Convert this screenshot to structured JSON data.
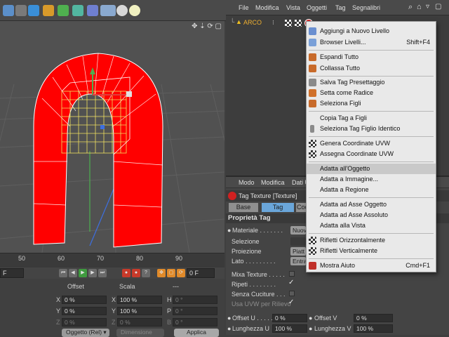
{
  "object_manager": {
    "menus": [
      "File",
      "Modifica",
      "Vista",
      "Oggetti",
      "Tag",
      "Segnalibri"
    ],
    "object_name": "ARCO"
  },
  "context_menu": {
    "items": [
      {
        "label": "Aggiungi a Nuovo Livello",
        "shortcut": ""
      },
      {
        "label": "Browser Livelli...",
        "shortcut": "Shift+F4"
      },
      {
        "label": "Espandi Tutto",
        "shortcut": ""
      },
      {
        "label": "Collassa Tutto",
        "shortcut": ""
      },
      {
        "label": "Salva Tag Presettaggio",
        "shortcut": ""
      },
      {
        "label": "Setta come Radice",
        "shortcut": ""
      },
      {
        "label": "Seleziona Figli",
        "shortcut": ""
      },
      {
        "label": "Copia Tag a Figli",
        "shortcut": ""
      },
      {
        "label": "Seleziona Tag Figlio Identico",
        "shortcut": ""
      },
      {
        "label": "Genera Coordinate UVW",
        "shortcut": ""
      },
      {
        "label": "Assegna Coordinate UVW",
        "shortcut": ""
      },
      {
        "label": "Adatta all'Oggetto",
        "shortcut": ""
      },
      {
        "label": "Adatta a Immagine...",
        "shortcut": ""
      },
      {
        "label": "Adatta a Regione",
        "shortcut": ""
      },
      {
        "label": "Adatta ad Asse Oggetto",
        "shortcut": ""
      },
      {
        "label": "Adatta ad Asse Assoluto",
        "shortcut": ""
      },
      {
        "label": "Adatta alla Vista",
        "shortcut": ""
      },
      {
        "label": "Rifletti Orizzontalmente",
        "shortcut": ""
      },
      {
        "label": "Rifletti Verticalmente",
        "shortcut": ""
      },
      {
        "label": "Mostra Aiuto",
        "shortcut": "Cmd+F1"
      }
    ]
  },
  "attribute_manager": {
    "menus": [
      "Modo",
      "Modifica",
      "Dati U"
    ],
    "title": "Tag Texture [Texture]",
    "tabs": [
      "Base",
      "Tag",
      "Coo"
    ],
    "section": "Proprietà Tag",
    "props": {
      "materiale": "Materiale . . . . . . .",
      "materiale_value": "Nuov",
      "selezione": "Selezione",
      "proiezione": "Proiezione",
      "proiezione_value": "Piatt",
      "lato": "Lato . . . . . . . . .",
      "lato_value": "Entra",
      "mixa": "Mixa Texture . . . . .",
      "ripeti": "Ripeti . . . . . . . .",
      "senza_cuciture": "Senza Cuciture . . .",
      "usa_uvw": "Usa UVW per Rilievo"
    },
    "offset_u_label": "Offset U . . . . .",
    "offset_u": "0 %",
    "offset_v_label": "Offset V",
    "offset_v": "0 %",
    "lunghezza_u_label": "Lunghezza U",
    "lunghezza_u": "100 %",
    "lunghezza_v_label": "Lunghezza V",
    "lunghezza_v": "100 %"
  },
  "timeline": {
    "ticks": [
      "50",
      "60",
      "70",
      "80",
      "90"
    ],
    "current_frame": "0 F",
    "start_frame": "F"
  },
  "coordinates": {
    "headers": [
      "Offset",
      "Scala",
      "---"
    ],
    "rows": [
      {
        "axis": "X",
        "offset": "0 %",
        "scale_axis": "X",
        "scale": "100 %",
        "rot_axis": "H",
        "rot": "0 °"
      },
      {
        "axis": "Y",
        "offset": "0 %",
        "scale_axis": "Y",
        "scale": "100 %",
        "rot_axis": "P",
        "rot": "0 °"
      },
      {
        "axis": "Z",
        "offset": "0 %",
        "scale_axis": "Z",
        "scale": "0 %",
        "rot_axis": "B",
        "rot": "0 °"
      }
    ],
    "mode_dropdown": "Oggetto (Rel) ▾",
    "dimension_dropdown": "Dimensione",
    "apply_button": "Applica"
  },
  "colors": {
    "accent_blue": "#6aa6da",
    "arch_red": "#ff0000",
    "menu_bg": "#e9e9e9"
  }
}
